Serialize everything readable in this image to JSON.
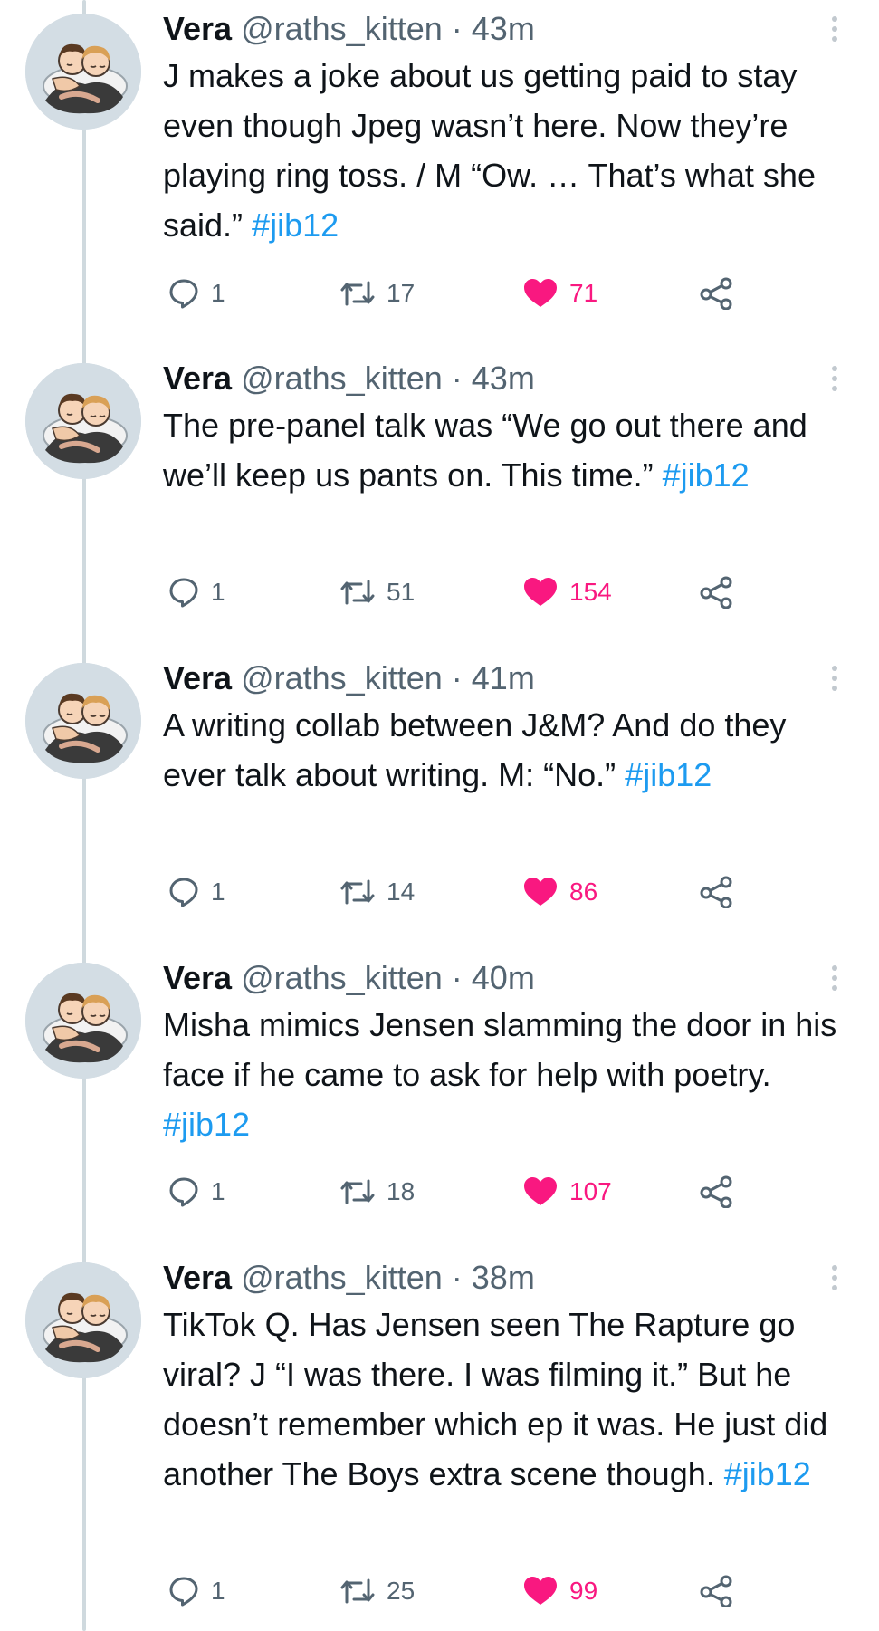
{
  "tweets": [
    {
      "name": "Vera",
      "handle": "@raths_kitten",
      "separator": "·",
      "time": "43m",
      "text": "J makes a joke about us getting paid to stay even though Jpeg wasn’t here. Now they’re playing ring toss. / M “Ow. … That’s what she said.” ",
      "hashtag": "#jib12",
      "replies": "1",
      "retweets": "17",
      "likes": "71"
    },
    {
      "name": "Vera",
      "handle": "@raths_kitten",
      "separator": "·",
      "time": "43m",
      "text": "The pre-panel talk was “We go out there and we’ll keep us pants on. This time.” ",
      "hashtag": "#jib12",
      "replies": "1",
      "retweets": "51",
      "likes": "154"
    },
    {
      "name": "Vera",
      "handle": "@raths_kitten",
      "separator": "·",
      "time": "41m",
      "text": "A writing collab between J&M? And do they ever talk about writing. M: “No.” ",
      "hashtag": "#jib12",
      "replies": "1",
      "retweets": "14",
      "likes": "86"
    },
    {
      "name": "Vera",
      "handle": "@raths_kitten",
      "separator": "·",
      "time": "40m",
      "text": "Misha mimics Jensen slamming the door in his face if he came to ask for help with poetry. ",
      "hashtag": "#jib12",
      "replies": "1",
      "retweets": "18",
      "likes": "107"
    },
    {
      "name": "Vera",
      "handle": "@raths_kitten",
      "separator": "·",
      "time": "38m",
      "text": "TikTok Q. Has Jensen seen The Rapture go viral? J “I was there. I was filming it.” But he doesn’t remember which ep it was. He just did another The Boys extra scene though. ",
      "hashtag": "#jib12",
      "replies": "1",
      "retweets": "25",
      "likes": "99"
    }
  ],
  "icons": {
    "reply": "reply-icon",
    "retweet": "retweet-icon",
    "like": "heart-icon",
    "share": "share-icon",
    "more": "more-options-icon",
    "avatar": "avatar-illustration"
  },
  "colors": {
    "hashtag": "#1d9bf0",
    "like": "#f91880",
    "muted": "#536471",
    "thread_line": "#cfd9de"
  }
}
